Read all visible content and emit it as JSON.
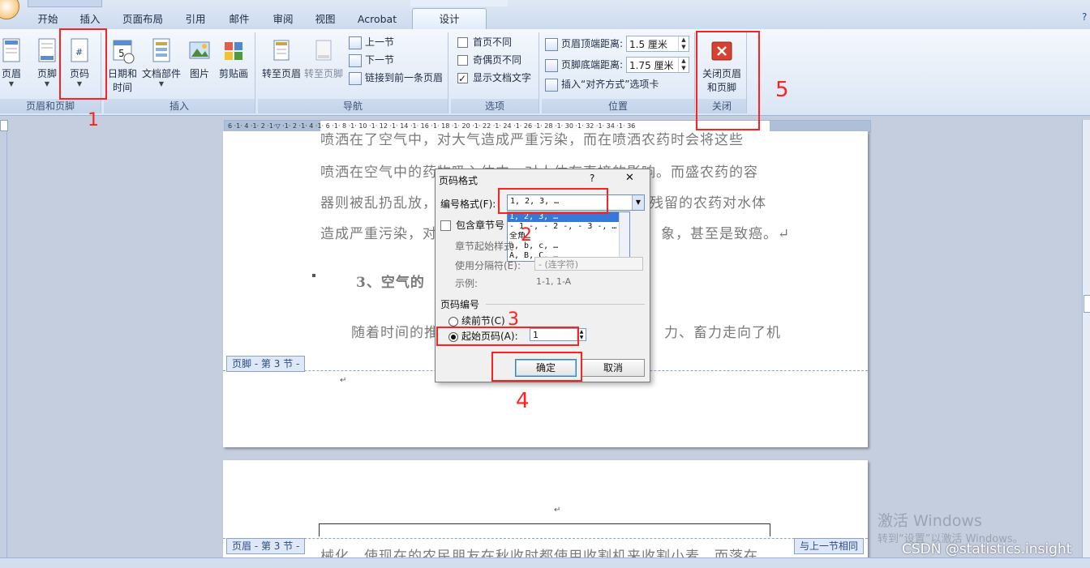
{
  "tabs": [
    "开始",
    "插入",
    "页面布局",
    "引用",
    "邮件",
    "审阅",
    "视图",
    "Acrobat",
    "设计"
  ],
  "ribbon": {
    "header_footer": {
      "header": "页眉",
      "footer": "页脚",
      "page_number": "页码",
      "label": "页眉和页脚"
    },
    "insert": {
      "date_time_1": "日期和",
      "date_time_2": "时间",
      "doc_parts": "文档部件",
      "picture": "图片",
      "clip_art": "剪贴画",
      "label": "插入"
    },
    "navigation": {
      "goto_header": "转至页眉",
      "goto_footer": "转至页脚",
      "prev_section": "上一节",
      "next_section": "下一节",
      "link_prev": "链接到前一条页眉",
      "label": "导航"
    },
    "options": {
      "first_page": "首页不同",
      "odd_even": "奇偶页不同",
      "show_text": "显示文档文字",
      "label": "选项"
    },
    "position": {
      "header_top": "页眉顶端距离:",
      "header_top_val": "1.5 厘米",
      "footer_bottom": "页脚底端距离:",
      "footer_bottom_val": "1.75 厘米",
      "insert_align": "插入“对齐方式”选项卡",
      "label": "位置"
    },
    "close": {
      "close_1": "关闭页眉",
      "close_2": "和页脚",
      "label": "关闭"
    }
  },
  "ruler_text": "6 ·1· 4 ·1· 2 ·1·▽ ·1· 2 ·1· 4 ·1· 6 ·1· 8 ·1· 10 ·1· 12 ·1· 14 ·1· 16 ·1· 18 ·1· 20 ·1· 22 ·1· 24 ·1· 26 ·1· 28 ·1· 30 ·1· 32 ·1· 34 ·1· 36",
  "page1": {
    "line0": "喷洒在了空气中，对大气造成严重污染，而在喷洒农药时会将这些",
    "line1a": "喷洒在空气中的药物吸入体内，对人体有直接的影响。而盛农药的容",
    "line2a": "器则被乱扔乱放，",
    "line2b": "残留的农药对水体",
    "line3a": "造成严重污染，对",
    "line3b": "象，甚至是致癌。↵",
    "heading": "3、空气的",
    "line4a": "随着时间的推",
    "line4b": "力、畜力走向了机",
    "footer_tag": "页脚 - 第 3 节 -",
    "return_mark": "↵"
  },
  "page2": {
    "return_mark": "↵",
    "header_tag": "页眉 - 第 3 节 -",
    "same_as_prev": "与上一节相同",
    "line": "械化。使现在的农民朋友在秋收时都使用收割机来收割小麦。而落在"
  },
  "dialog": {
    "title": "页码格式",
    "help": "?",
    "close": "✕",
    "format_label": "编号格式(F):",
    "format_value": "1, 2, 3, …",
    "format_options": [
      "1, 2, 3, …",
      "- 1 -, - 2 -, - 3 -, …",
      "全角…",
      "a, b, c, …",
      "A, B, C, …"
    ],
    "include_chapter": "包含章节号",
    "chapter_start": "章节起始样式",
    "separator_label": "使用分隔符(E):",
    "separator_value": "- (连字符)",
    "example_label": "示例:",
    "example_value": "1-1, 1-A",
    "numbering_section": "页码编号",
    "continue_prev": "续前节(C)",
    "start_at": "起始页码(A):",
    "start_value": "1",
    "ok": "确定",
    "cancel": "取消"
  },
  "annotations": [
    "1",
    "2",
    "3",
    "4",
    "5"
  ],
  "watermark": {
    "line1": "激活 Windows",
    "line2": "转到“设置”以激活 Windows。"
  },
  "credit": "CSDN @statistics.insight"
}
